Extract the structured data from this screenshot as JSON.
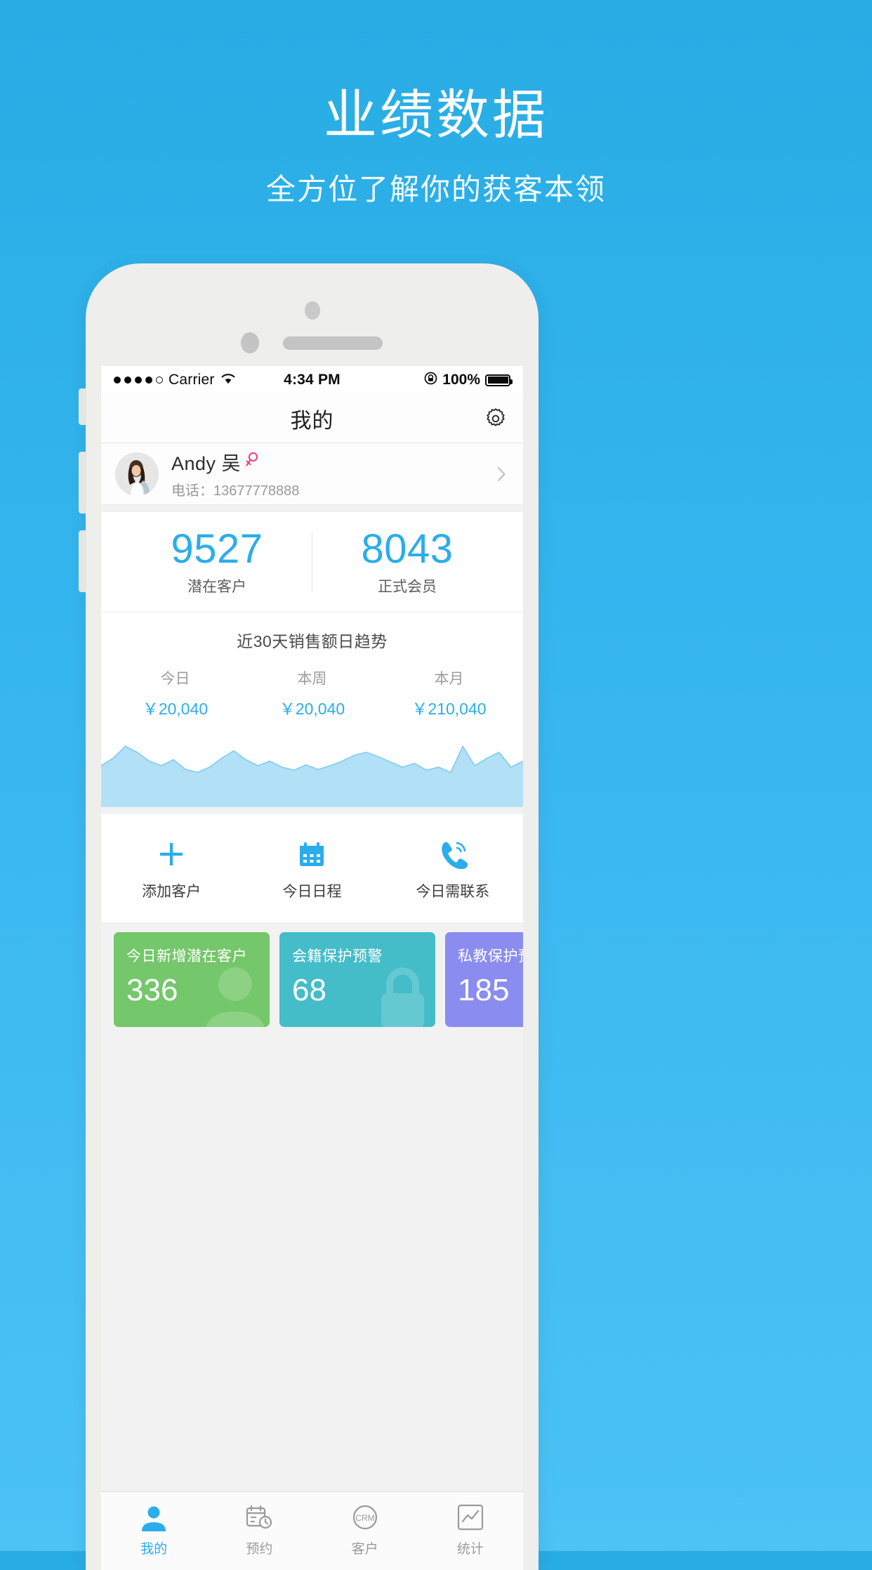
{
  "promo": {
    "title": "业绩数据",
    "subtitle": "全方位了解你的获客本领"
  },
  "colors": {
    "background_blue": "#2badeb",
    "accent_blue": "#2badeb",
    "card_green": "#74c76a",
    "card_teal": "#44bdc8",
    "card_purple": "#8b8cf0",
    "gender_pink": "#f0387f",
    "chart_fill": "#b2e0f7"
  },
  "status_bar": {
    "signal_dots_filled": 4,
    "signal_dots_total": 5,
    "carrier": "Carrier",
    "wifi_icon": "wifi-icon",
    "time": "4:34 PM",
    "rotation_lock_icon": "rotation-lock-icon",
    "battery_percent": "100%",
    "battery_icon": "battery-full-icon"
  },
  "nav": {
    "title": "我的",
    "settings_icon": "gear-icon"
  },
  "profile": {
    "avatar_icon": "user-avatar",
    "name": "Andy 吴",
    "gender_icon": "female-icon",
    "phone": "电话：13677778888",
    "chevron_icon": "chevron-right-icon"
  },
  "stats": [
    {
      "value": "9527",
      "label": "潜在客户"
    },
    {
      "value": "8043",
      "label": "正式会员"
    }
  ],
  "trend": {
    "title": "近30天销售额日趋势",
    "columns": [
      {
        "label": "今日",
        "value": "￥20,040"
      },
      {
        "label": "本周",
        "value": "￥20,040"
      },
      {
        "label": "本月",
        "value": "￥210,040"
      }
    ]
  },
  "chart_data": {
    "type": "area",
    "title": "近30天销售额日趋势",
    "xlabel": "",
    "ylabel": "",
    "grid": false,
    "legend": "none",
    "ylim": [
      0,
      100
    ],
    "x": [
      0,
      1,
      2,
      3,
      4,
      5,
      6,
      7,
      8,
      9,
      10,
      11,
      12,
      13,
      14,
      15,
      16,
      17,
      18,
      19,
      20,
      21,
      22,
      23,
      24,
      25,
      26,
      27,
      28,
      29,
      30,
      31,
      32,
      33,
      34,
      35
    ],
    "values": [
      52,
      62,
      78,
      70,
      58,
      52,
      60,
      47,
      43,
      50,
      62,
      72,
      60,
      52,
      58,
      50,
      46,
      53,
      47,
      52,
      58,
      66,
      70,
      64,
      57,
      50,
      55,
      46,
      50,
      43,
      78,
      52,
      62,
      70,
      50,
      58
    ]
  },
  "actions": [
    {
      "icon": "plus-icon",
      "label": "添加客户"
    },
    {
      "icon": "calendar-icon",
      "label": "今日日程"
    },
    {
      "icon": "phone-call-icon",
      "label": "今日需联系"
    }
  ],
  "metrics": [
    {
      "label": "今日新增潜在客户",
      "value": "336",
      "color": "#74c76a",
      "watermark_icon": "user-silhouette-icon"
    },
    {
      "label": "会籍保护预警",
      "value": "68",
      "color": "#44bdc8",
      "watermark_icon": "lock-icon"
    },
    {
      "label": "私教保护预警",
      "value": "185",
      "color": "#8b8cf0",
      "watermark_icon": "lock-icon"
    }
  ],
  "tabs": [
    {
      "icon": "person-icon",
      "label": "我的",
      "active": true
    },
    {
      "icon": "calendar-clock-icon",
      "label": "预约",
      "active": false
    },
    {
      "icon": "crm-icon",
      "label": "客户",
      "active": false
    },
    {
      "icon": "chart-icon",
      "label": "统计",
      "active": false
    }
  ]
}
